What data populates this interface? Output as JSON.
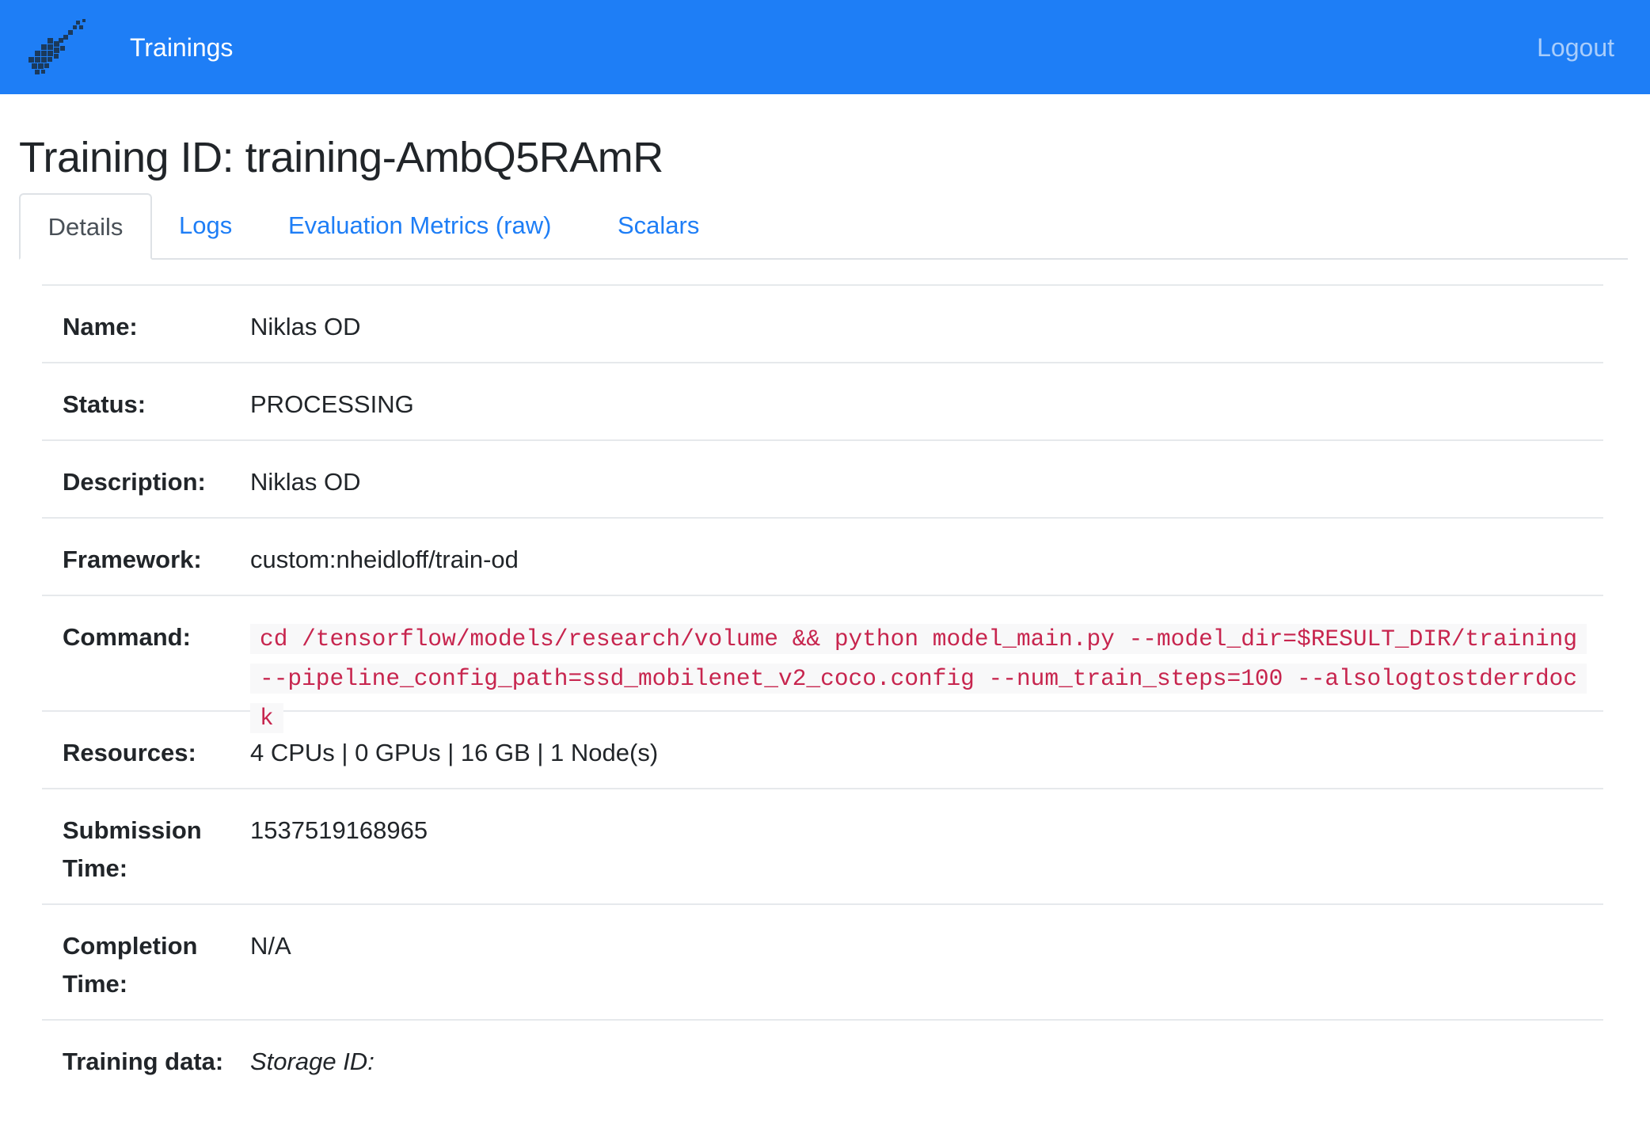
{
  "navbar": {
    "title": "Trainings",
    "logout": "Logout",
    "logo_icon": "guitar-logo-icon",
    "color": "#1e7ef6"
  },
  "page": {
    "title": "Training ID: training-AmbQ5RAmR"
  },
  "tabs": [
    {
      "label": "Details",
      "active": true
    },
    {
      "label": "Logs",
      "active": false
    },
    {
      "label": "Evaluation Metrics (raw)",
      "active": false
    },
    {
      "label": "Scalars",
      "active": false
    }
  ],
  "details": {
    "name": {
      "label": "Name:",
      "value": "Niklas OD"
    },
    "status": {
      "label": "Status:",
      "value": "PROCESSING"
    },
    "description": {
      "label": "Description:",
      "value": "Niklas OD"
    },
    "framework": {
      "label": "Framework:",
      "value": "custom:nheidloff/train-od"
    },
    "command": {
      "label": "Command:",
      "value": "cd /tensorflow/models/research/volume && python model_main.py --model_dir=$RESULT_DIR/training --pipeline_config_path=ssd_mobilenet_v2_coco.config --num_train_steps=100 --alsologtostderrdock"
    },
    "resources": {
      "label": "Resources:",
      "value": "4 CPUs | 0 GPUs | 16 GB | 1 Node(s)"
    },
    "submission_time": {
      "label": "Submission Time:",
      "value": "1537519168965"
    },
    "completion_time": {
      "label": "Completion Time:",
      "value": "N/A"
    },
    "training_data": {
      "label": "Training data:",
      "value": "Storage ID:"
    }
  }
}
